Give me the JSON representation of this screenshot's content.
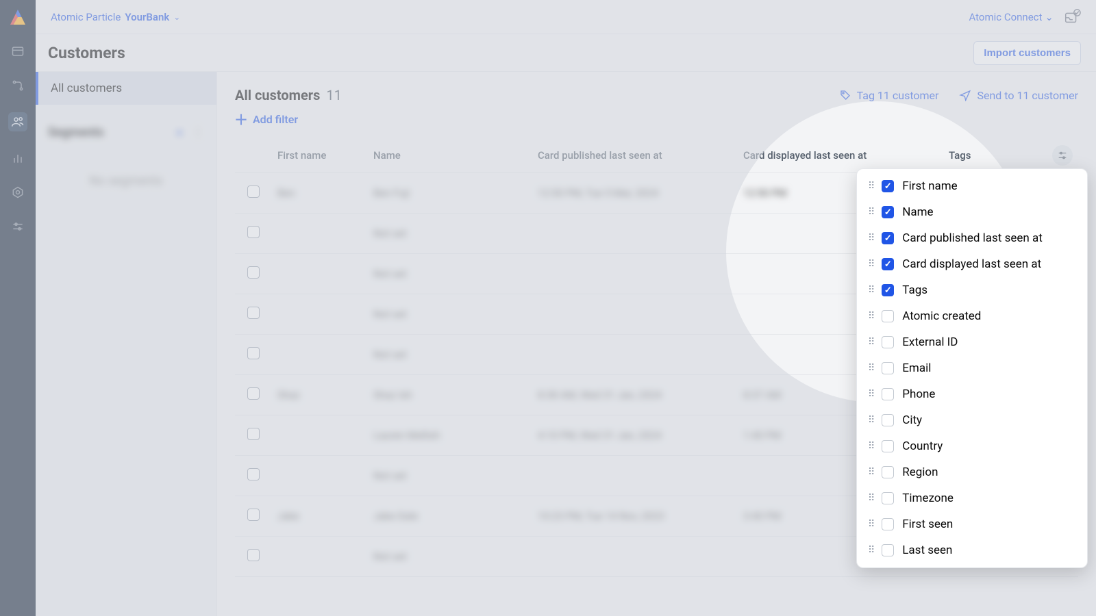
{
  "breadcrumb": {
    "org": "Atomic Particle",
    "project": "YourBank"
  },
  "top_right": {
    "connect": "Atomic Connect"
  },
  "page_title": "Customers",
  "import_btn": "Import customers",
  "sidebar": {
    "all_customers": "All customers",
    "segments_label": "Segments",
    "no_segments": "No segments"
  },
  "list": {
    "title": "All customers",
    "count": "11",
    "tag_action": "Tag 11 customer",
    "send_action": "Send to 11 customer",
    "add_filter": "Add filter"
  },
  "columns": {
    "first_name": "First name",
    "name": "Name",
    "card_published": "Card published last seen at",
    "card_displayed": "Card displayed last seen at",
    "tags": "Tags"
  },
  "rows": [
    {
      "first": "Ben",
      "name": "Ben Fuji",
      "pub": "12:50 PM, Tue 5 Mar, 2024",
      "disp": "12:50 PM"
    },
    {
      "first": "",
      "name": "Not set",
      "pub": "",
      "disp": ""
    },
    {
      "first": "",
      "name": "Not set",
      "pub": "",
      "disp": ""
    },
    {
      "first": "",
      "name": "Not set",
      "pub": "",
      "disp": ""
    },
    {
      "first": "",
      "name": "Not set",
      "pub": "",
      "disp": ""
    },
    {
      "first": "Shaz",
      "name": "Shaz Ish",
      "pub": "8:38 AM, Wed 31 Jan, 2024",
      "disp": "8:37 AM"
    },
    {
      "first": "",
      "name": "Lauren Mellish",
      "pub": "4:10 PM, Wed 31 Jan, 2024",
      "disp": "1:40 PM"
    },
    {
      "first": "",
      "name": "Not set",
      "pub": "",
      "disp": ""
    },
    {
      "first": "Jake",
      "name": "Jake Dale",
      "pub": "10:23 PM, Tue 14 Nov, 2023",
      "disp": "3:40 PM"
    },
    {
      "first": "",
      "name": "Not set",
      "pub": "",
      "disp": ""
    }
  ],
  "column_picker": [
    {
      "label": "First name",
      "checked": true
    },
    {
      "label": "Name",
      "checked": true
    },
    {
      "label": "Card published last seen at",
      "checked": true
    },
    {
      "label": "Card displayed last seen at",
      "checked": true
    },
    {
      "label": "Tags",
      "checked": true
    },
    {
      "label": "Atomic created",
      "checked": false
    },
    {
      "label": "External ID",
      "checked": false
    },
    {
      "label": "Email",
      "checked": false
    },
    {
      "label": "Phone",
      "checked": false
    },
    {
      "label": "City",
      "checked": false
    },
    {
      "label": "Country",
      "checked": false
    },
    {
      "label": "Region",
      "checked": false
    },
    {
      "label": "Timezone",
      "checked": false
    },
    {
      "label": "First seen",
      "checked": false
    },
    {
      "label": "Last seen",
      "checked": false
    }
  ]
}
